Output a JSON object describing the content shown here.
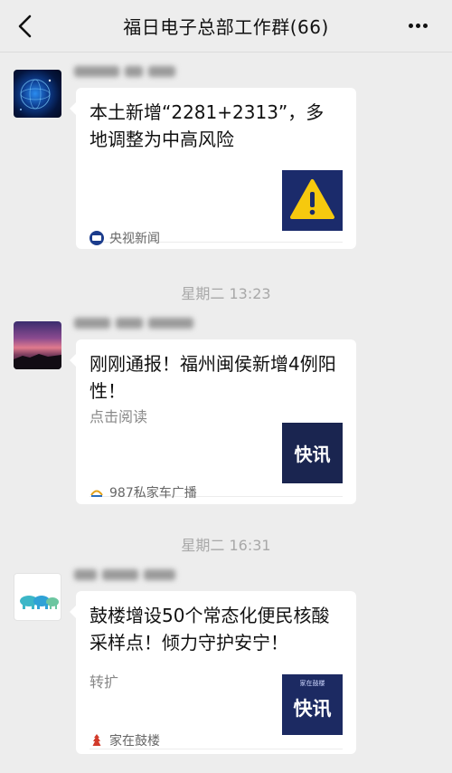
{
  "header": {
    "title": "福日电子总部工作群(66)",
    "back_icon": "chevron-left-icon",
    "more_icon": "more-dots-icon"
  },
  "messages": [
    {
      "card_title": "本土新增“2281+2313”，多地调整为中高风险",
      "thumb_icon": "warning-icon",
      "source": "央视新闻",
      "source_icon_text": "央视新闻"
    },
    {
      "card_title": "刚刚通报！福州闽侯新增4例阳性！",
      "description": "点击阅读",
      "thumb_text": "快讯",
      "source": "987私家车广播"
    },
    {
      "card_title": "鼓楼增设50个常态化便民核酸采样点！倾力守护安宁！",
      "description": "转扩",
      "thumb_text": "快讯",
      "thumb_caption": "家在鼓楼",
      "source": "家在鼓楼"
    }
  ],
  "timestamps": [
    "星期二 13:23",
    "星期二 16:31"
  ],
  "colors": {
    "background": "#ededed",
    "card": "#ffffff",
    "warning_yellow": "#f6c90e",
    "thumb_navy": "#1a2550"
  }
}
